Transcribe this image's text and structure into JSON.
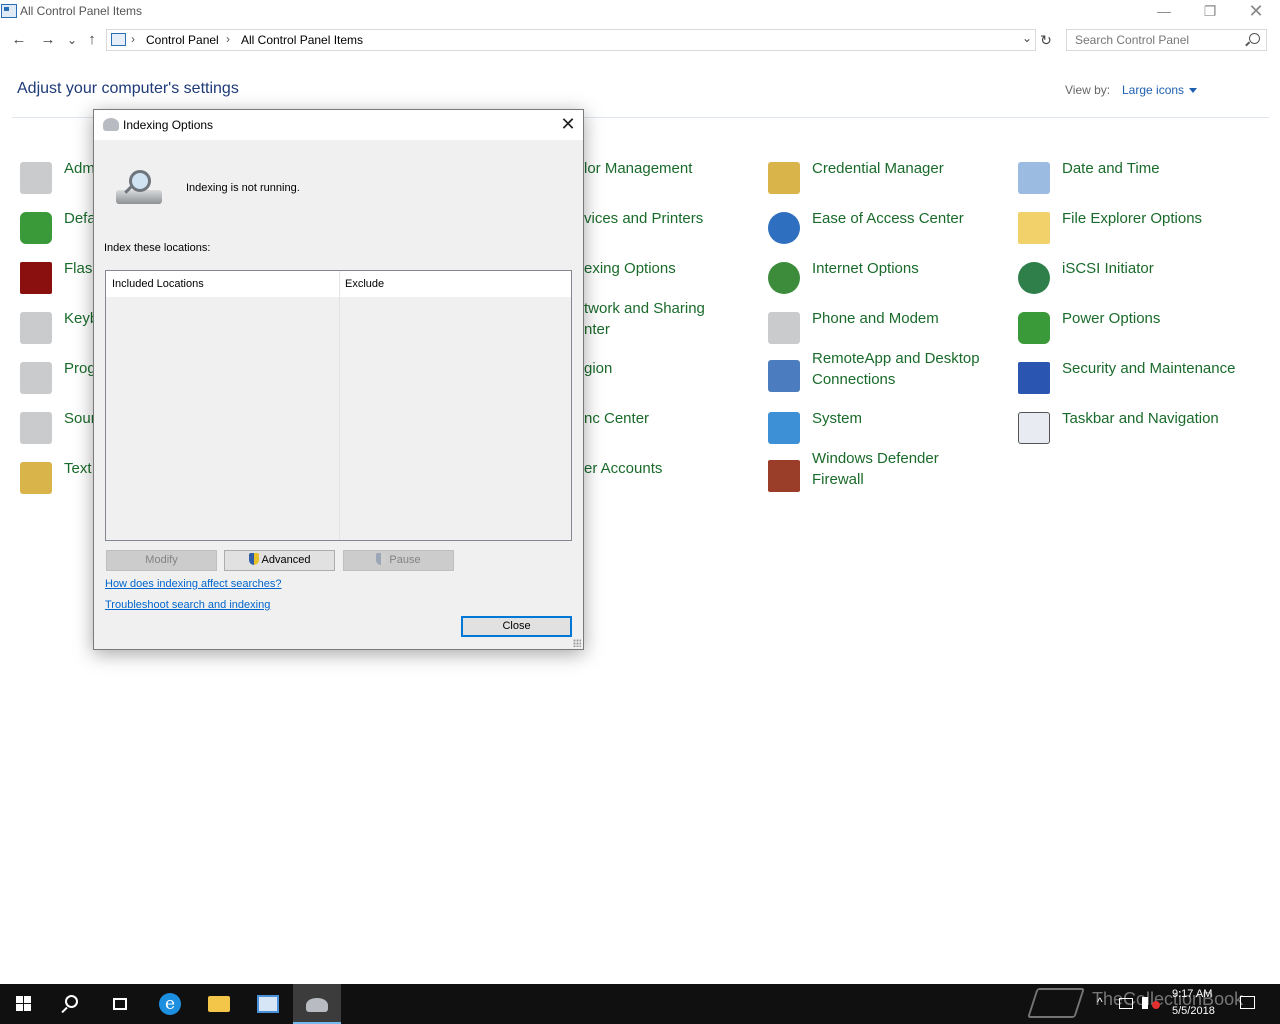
{
  "window": {
    "title": "All Control Panel Items",
    "minimize_glyph": "—",
    "maximize_glyph": "❐",
    "close_glyph": "✕"
  },
  "nav": {
    "back_glyph": "←",
    "forward_glyph": "→",
    "history_glyph": "⌄",
    "up_glyph": "↑",
    "separator_glyph": "›",
    "breadcrumbs": [
      "Control Panel",
      "All Control Panel Items"
    ],
    "dropdown_glyph": "⌄",
    "refresh_glyph": "↻",
    "search_placeholder": "Search Control Panel"
  },
  "header": {
    "title": "Adjust your computer's settings",
    "view_by_label": "View by:",
    "view_by_value": "Large icons"
  },
  "items": [
    {
      "label": "Adm",
      "icon": "administrative-tools-icon"
    },
    {
      "label": "Defa",
      "icon": "default-programs-icon"
    },
    {
      "label": "Flash",
      "icon": "flash-player-icon"
    },
    {
      "label": "Keyb",
      "icon": "keyboard-icon"
    },
    {
      "label": "Prog",
      "icon": "programs-icon"
    },
    {
      "label": "Sour",
      "icon": "sound-icon"
    },
    {
      "label": "Text t",
      "icon": "text-to-speech-icon"
    },
    {
      "label": "lor Management",
      "icon": "color-management-icon"
    },
    {
      "label": "vices and Printers",
      "icon": "devices-printers-icon"
    },
    {
      "label": "exing Options",
      "icon": "indexing-options-icon"
    },
    {
      "label": "twork and Sharing\nnter",
      "icon": "network-sharing-icon"
    },
    {
      "label": "gion",
      "icon": "region-icon"
    },
    {
      "label": "nc Center",
      "icon": "sync-center-icon"
    },
    {
      "label": "er Accounts",
      "icon": "user-accounts-icon"
    },
    {
      "label": "Credential Manager",
      "icon": "credential-manager-icon"
    },
    {
      "label": "Ease of Access Center",
      "icon": "ease-of-access-icon"
    },
    {
      "label": "Internet Options",
      "icon": "internet-options-icon"
    },
    {
      "label": "Phone and Modem",
      "icon": "phone-modem-icon"
    },
    {
      "label": "RemoteApp and Desktop\nConnections",
      "icon": "remoteapp-icon"
    },
    {
      "label": "System",
      "icon": "system-icon"
    },
    {
      "label": "Windows Defender\nFirewall",
      "icon": "firewall-icon"
    },
    {
      "label": "Date and Time",
      "icon": "date-time-icon"
    },
    {
      "label": "File Explorer Options",
      "icon": "file-explorer-options-icon"
    },
    {
      "label": "iSCSI Initiator",
      "icon": "iscsi-initiator-icon"
    },
    {
      "label": "Power Options",
      "icon": "power-options-icon"
    },
    {
      "label": "Security and Maintenance",
      "icon": "security-maintenance-icon"
    },
    {
      "label": "Taskbar and Navigation",
      "icon": "taskbar-navigation-icon"
    }
  ],
  "dialog": {
    "title": "Indexing Options",
    "close_glyph": "✕",
    "status": "Indexing is not running.",
    "locations_label": "Index these locations:",
    "columns": [
      "Included Locations",
      "Exclude"
    ],
    "buttons": {
      "modify": "Modify",
      "advanced": "Advanced",
      "pause": "Pause",
      "close": "Close"
    },
    "links": {
      "how": "How does indexing affect searches?",
      "troubleshoot": "Troubleshoot search and indexing"
    }
  },
  "taskbar": {
    "watermark": "TheCollectionBook",
    "tray_chevron": "^",
    "time": "9:17 AM",
    "date": "5/5/2018"
  },
  "colors": {
    "link_green": "#1a6b2b",
    "title_blue": "#1e3a78",
    "accent": "#0078d7"
  }
}
